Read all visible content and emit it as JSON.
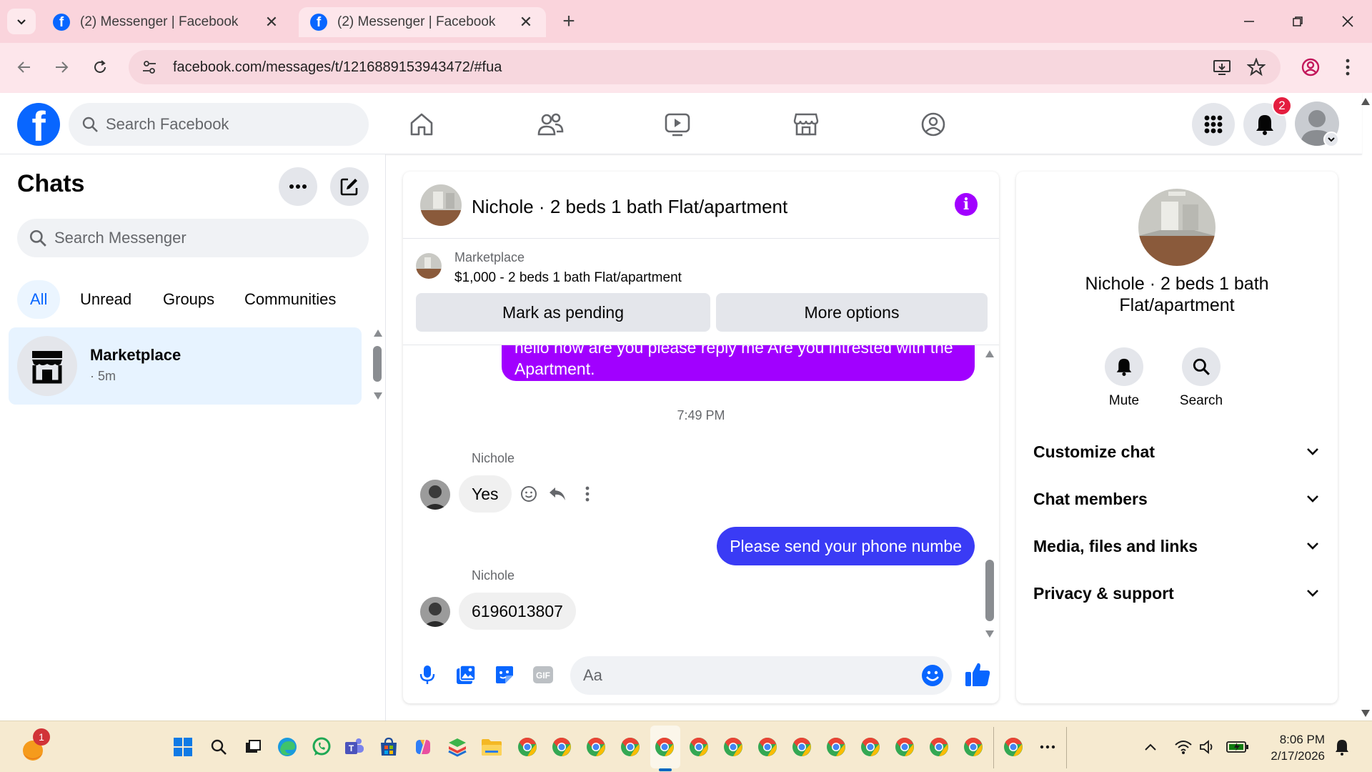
{
  "browser": {
    "tabs": [
      {
        "title": "(2) Messenger | Facebook",
        "active": false
      },
      {
        "title": "(2) Messenger | Facebook",
        "active": true
      }
    ],
    "url": "facebook.com/messages/t/1216889153943472/#fua"
  },
  "facebook": {
    "search_placeholder": "Search Facebook",
    "notification_count": "2"
  },
  "sidebar": {
    "title": "Chats",
    "search_placeholder": "Search Messenger",
    "filters": [
      "All",
      "Unread",
      "Groups",
      "Communities"
    ],
    "active_filter": "All",
    "chats": [
      {
        "name": "Marketplace",
        "time": "· 5m",
        "icon": "marketplace-store-icon"
      }
    ]
  },
  "conversation": {
    "title": "Nichole · 2 beds 1 bath Flat/apartment",
    "marketplace_label": "Marketplace",
    "listing": "$1,000 - 2 beds 1 bath Flat/apartment",
    "mark_pending_label": "Mark as pending",
    "more_options_label": "More options",
    "messages": {
      "outgoing_partial": "hello how are you please reply me Are you intrested  with the Apartment.",
      "timestamp": "7:49 PM",
      "sender1": "Nichole",
      "incoming1": "Yes",
      "outgoing1": "Please send your phone numbe",
      "sender2": "Nichole",
      "incoming2": "6196013807"
    },
    "composer_placeholder": "Aa"
  },
  "details": {
    "name": "Nichole · 2 beds 1 bath Flat/apartment",
    "actions": [
      {
        "label": "Mute",
        "icon": "bell-icon"
      },
      {
        "label": "Search",
        "icon": "search-icon"
      }
    ],
    "sections": [
      "Customize chat",
      "Chat members",
      "Media, files and links",
      "Privacy & support"
    ]
  },
  "taskbar": {
    "time": "8:06 PM",
    "date": "2/17/2026",
    "start_badge": "1"
  },
  "colors": {
    "fb_blue": "#0866ff",
    "purple_bubble": "#a100ff",
    "blue_bubble": "#3a3bf5",
    "browser_chrome": "#fad4dc"
  }
}
